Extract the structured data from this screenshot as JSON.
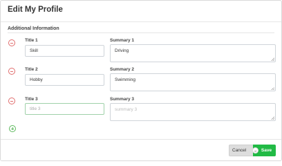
{
  "modal": {
    "title": "Edit My Profile",
    "section_title": "Additional Information"
  },
  "rows": [
    {
      "title_label": "Title 1",
      "title_value": "Skill",
      "title_placeholder": "",
      "summary_label": "Summary 1",
      "summary_value": "Driving",
      "summary_placeholder": ""
    },
    {
      "title_label": "Title 2",
      "title_value": "Hobby",
      "title_placeholder": "",
      "summary_label": "Summary 2",
      "summary_value": "Swimming",
      "summary_placeholder": ""
    },
    {
      "title_label": "Title 3",
      "title_value": "",
      "title_placeholder": "title 3",
      "summary_label": "Summary 3",
      "summary_value": "",
      "summary_placeholder": "summary 3"
    }
  ],
  "footer": {
    "cancel_label": "Cancel",
    "or_label": "or",
    "save_label": "Save"
  },
  "colors": {
    "remove": "#e06c6c",
    "add": "#5cb85c",
    "save": "#21ba45"
  },
  "icons": {
    "remove": "minus-circle-icon",
    "add": "plus-circle-icon"
  }
}
